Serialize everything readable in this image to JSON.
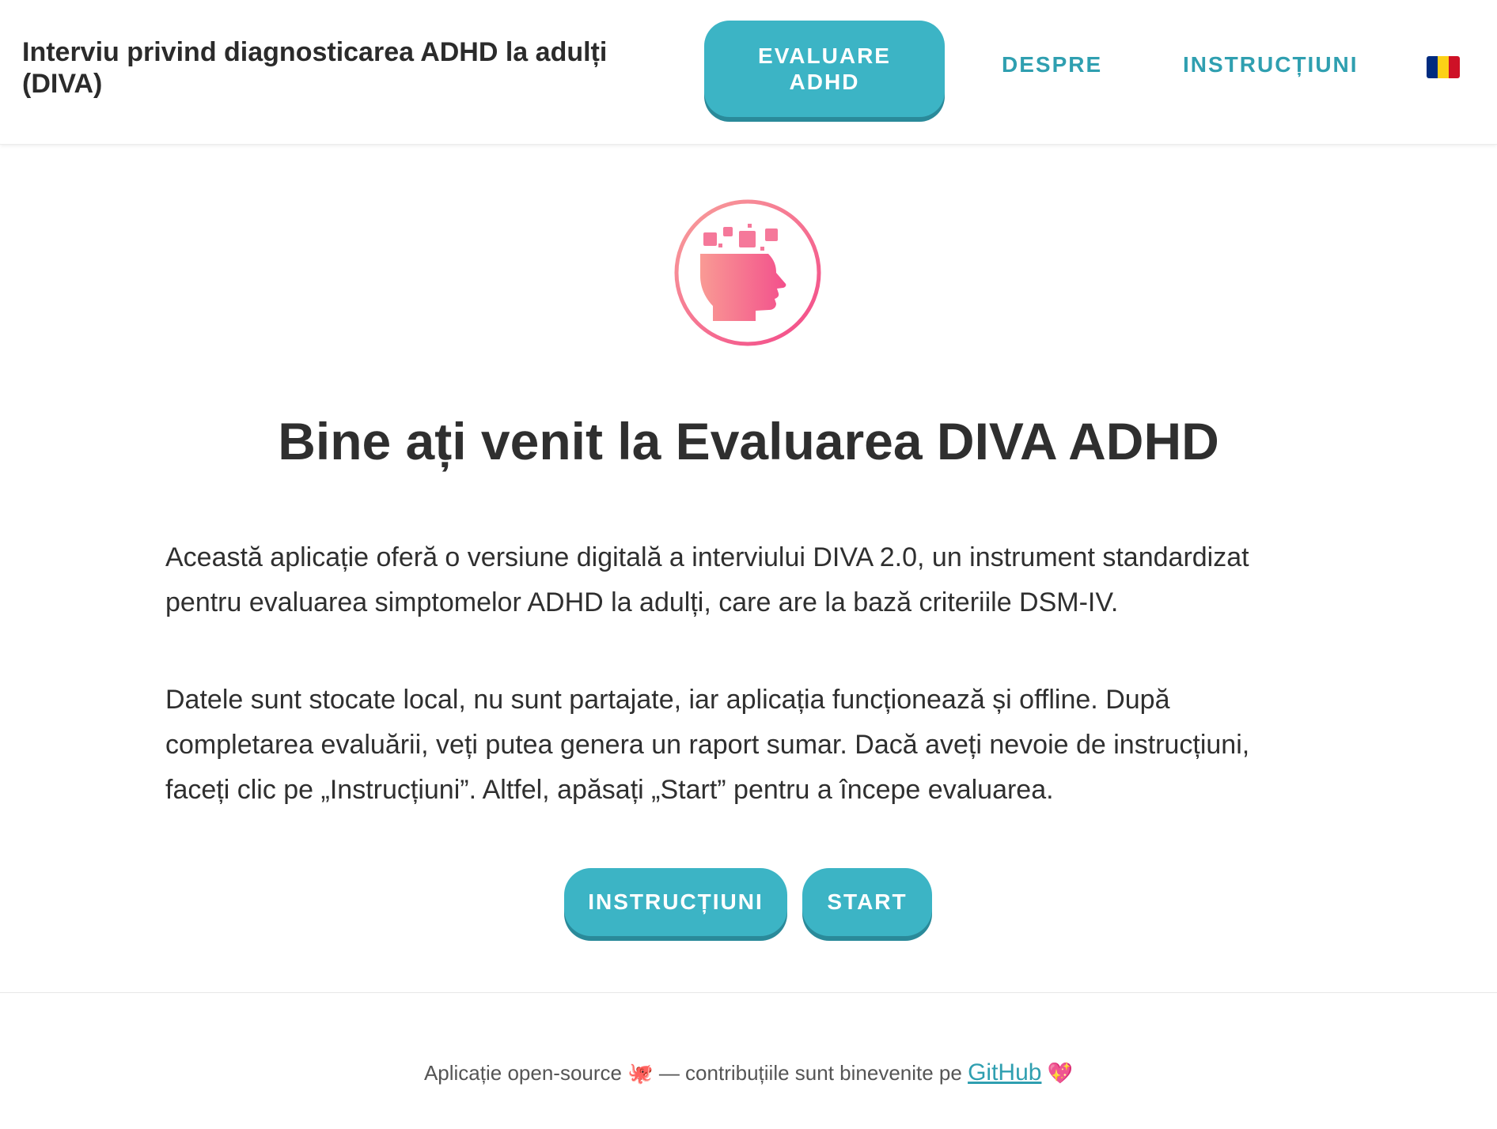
{
  "header": {
    "title": "Interviu privind diagnosticarea ADHD la adulți (DIVA)",
    "nav_primary": "EVALUARE ADHD",
    "nav_about": "DESPRE",
    "nav_instructions": "INSTRUCȚIUNI",
    "language_flag": "romania-flag",
    "flag_colors": [
      "#002b7f",
      "#fcd116",
      "#ce1126"
    ]
  },
  "logo": {
    "icon": "head-brain-icon",
    "gradient_colors": [
      "#f8a09a",
      "#f3498a"
    ]
  },
  "main": {
    "title": "Bine ați venit la Evaluarea DIVA ADHD",
    "paragraph1": "Această aplicație oferă o versiune digitală a interviului DIVA 2.0, un instrument standardizat pentru evaluarea simptomelor ADHD la adulți, care are la bază criteriile DSM-IV.",
    "paragraph2": "Datele sunt stocate local, nu sunt partajate, iar aplicația funcționează și offline. După completarea evaluării, veți putea genera un raport sumar. Dacă aveți nevoie de instrucțiuni, faceți clic pe „Instrucțiuni”. Altfel, apăsați „Start” pentru a începe evaluarea.",
    "btn_instructions": "INSTRUCȚIUNI",
    "btn_start": "START"
  },
  "footer": {
    "text_before": "Aplicație open-source",
    "emoji_octopus": "🐙",
    "text_middle": " — contribuțiile sunt binevenite pe ",
    "link": "GitHub",
    "emoji_heart": "💖"
  },
  "colors": {
    "accent": "#3cb4c5",
    "accent_shadow": "#2a8a9a",
    "link": "#2f9fb0",
    "text": "#2f2f2f"
  }
}
